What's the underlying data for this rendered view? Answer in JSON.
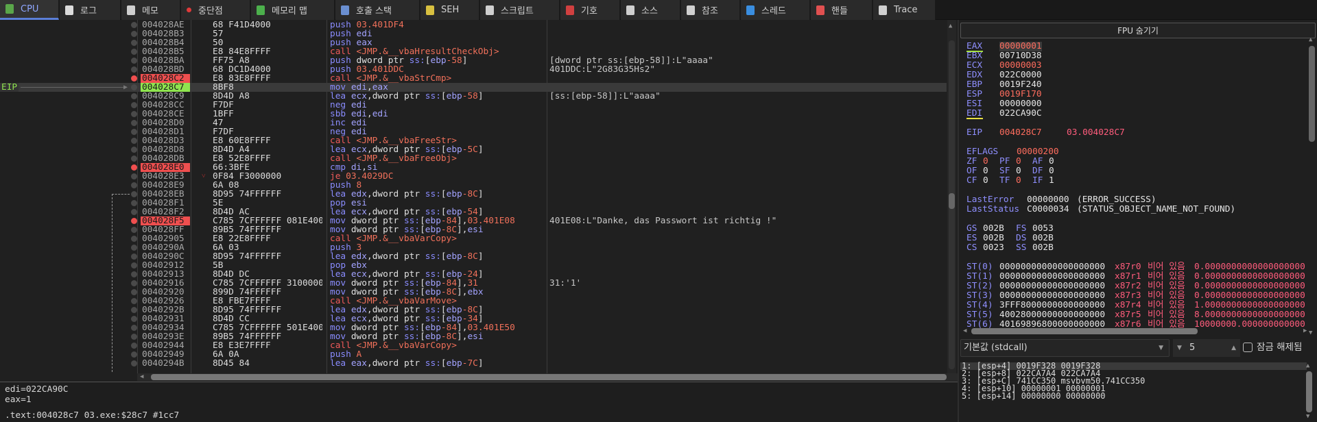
{
  "tabs": [
    {
      "label": "CPU",
      "active": true,
      "icon_color": "#5aa64a",
      "icon": "cpu-icon"
    },
    {
      "label": "로그",
      "icon_color": "#dcdcdc",
      "icon": "log-icon"
    },
    {
      "label": "메모",
      "icon_color": "#cfcfcf",
      "icon": "notes-icon"
    },
    {
      "label": "중단점",
      "icon_color": "#e03a3a",
      "icon": "breakpoint-icon"
    },
    {
      "label": "메모리 맵",
      "icon_color": "#4cb04c",
      "icon": "memory-map-icon"
    },
    {
      "label": "호출 스택",
      "icon_color": "#6a8fd0",
      "icon": "call-stack-icon"
    },
    {
      "label": "SEH",
      "icon_color": "#d8c040",
      "icon": "seh-icon"
    },
    {
      "label": "스크립트",
      "icon_color": "#d0d0d0",
      "icon": "script-icon"
    },
    {
      "label": "기호",
      "icon_color": "#d04040",
      "icon": "symbols-icon"
    },
    {
      "label": "소스",
      "icon_color": "#cfcfcf",
      "icon": "source-icon"
    },
    {
      "label": "참조",
      "icon_color": "#d0d0d0",
      "icon": "references-icon"
    },
    {
      "label": "스레드",
      "icon_color": "#3a8ee0",
      "icon": "threads-icon"
    },
    {
      "label": "핸들",
      "icon_color": "#e05050",
      "icon": "handles-icon"
    },
    {
      "label": "Trace",
      "icon_color": "#d0d0d0",
      "icon": "trace-icon"
    }
  ],
  "eip_label": "EIP",
  "disasm": [
    {
      "addr": "004028AE",
      "bytes": "68 ",
      "bytes_ul": "F41D4000",
      "ins": "push 03.401DF4",
      "cmt": ""
    },
    {
      "addr": "004028B3",
      "bytes": "57",
      "ins": "push edi",
      "cmt": ""
    },
    {
      "addr": "004028B4",
      "bytes": "50",
      "ins": "push eax",
      "cmt": ""
    },
    {
      "addr": "004028B5",
      "bytes": "E8 84E8FFFF",
      "ins": "call <JMP.&__vbaHresultCheckObj>",
      "cmt": ""
    },
    {
      "addr": "004028BA",
      "bytes": "FF75 A8",
      "ins": "push dword ptr ss:[ebp-58]",
      "cmt": "[dword ptr ss:[ebp-58]]:L\"aaaa\""
    },
    {
      "addr": "004028BD",
      "bytes": "68 ",
      "bytes_ul": "DC1D4000",
      "ins": "push 03.401DDC",
      "cmt": "401DDC:L\"2G83G35Hs2\""
    },
    {
      "addr": "004028C2",
      "bp": true,
      "bytes": "E8 83E8FFFF",
      "ins": "call <JMP.&__vbaStrCmp>",
      "cmt": ""
    },
    {
      "addr": "004028C7",
      "eip": true,
      "bytes": "8BF8",
      "ins": "mov edi,eax",
      "cmt": ""
    },
    {
      "addr": "004028C9",
      "bytes": "8D4D A8",
      "ins": "lea ecx,dword ptr ss:[ebp-58]",
      "cmt": "[ss:[ebp-58]]:L\"aaaa\""
    },
    {
      "addr": "004028CC",
      "bytes": "F7DF",
      "ins": "neg edi",
      "cmt": ""
    },
    {
      "addr": "004028CE",
      "bytes": "1BFF",
      "ins": "sbb edi,edi",
      "cmt": ""
    },
    {
      "addr": "004028D0",
      "bytes": "47",
      "ins": "inc edi",
      "cmt": ""
    },
    {
      "addr": "004028D1",
      "bytes": "F7DF",
      "ins": "neg edi",
      "cmt": ""
    },
    {
      "addr": "004028D3",
      "bytes": "E8 60E8FFFF",
      "ins": "call <JMP.&__vbaFreeStr>",
      "cmt": ""
    },
    {
      "addr": "004028D8",
      "bytes": "8D4D A4",
      "ins": "lea ecx,dword ptr ss:[ebp-5C]",
      "cmt": ""
    },
    {
      "addr": "004028DB",
      "bytes": "E8 52E8FFFF",
      "ins": "call <JMP.&__vbaFreeObj>",
      "cmt": ""
    },
    {
      "addr": "004028E0",
      "bp": true,
      "bytes": "66:3BFE",
      "ins": "cmp di,si",
      "cmt": ""
    },
    {
      "addr": "004028E3",
      "jump": true,
      "bytes": "0F84 F3000000",
      "ins": "je 03.4029DC",
      "cmt": ""
    },
    {
      "addr": "004028E9",
      "bytes": "6A 08",
      "ins": "push 8",
      "cmt": ""
    },
    {
      "addr": "004028EB",
      "bytes": "8D95 74FFFFFF",
      "ins": "lea edx,dword ptr ss:[ebp-8C]",
      "cmt": ""
    },
    {
      "addr": "004028F1",
      "bytes": "5E",
      "ins": "pop esi",
      "cmt": ""
    },
    {
      "addr": "004028F2",
      "bytes": "8D4D AC",
      "ins": "lea ecx,dword ptr ss:[ebp-54]",
      "cmt": ""
    },
    {
      "addr": "004028F5",
      "bp": true,
      "bytes": "C785 7CFFFFFF ",
      "bytes_ul": "081E400",
      "ins": "mov dword ptr ss:[ebp-84],03.401E08",
      "cmt": "401E08:L\"Danke, das Passwort ist richtig !\""
    },
    {
      "addr": "004028FF",
      "bytes": "89B5 74FFFFFF",
      "ins": "mov dword ptr ss:[ebp-8C],esi",
      "cmt": ""
    },
    {
      "addr": "00402905",
      "bytes": "E8 22E8FFFF",
      "ins": "call <JMP.&__vbaVarCopy>",
      "cmt": ""
    },
    {
      "addr": "0040290A",
      "bytes": "6A 03",
      "ins": "push 3",
      "cmt": ""
    },
    {
      "addr": "0040290C",
      "bytes": "8D95 74FFFFFF",
      "ins": "lea edx,dword ptr ss:[ebp-8C]",
      "cmt": ""
    },
    {
      "addr": "00402912",
      "bytes": "5B",
      "ins": "pop ebx",
      "cmt": ""
    },
    {
      "addr": "00402913",
      "bytes": "8D4D DC",
      "ins": "lea ecx,dword ptr ss:[ebp-24]",
      "cmt": ""
    },
    {
      "addr": "00402916",
      "bytes": "C785 7CFFFFFF 3100000",
      "ins": "mov dword ptr ss:[ebp-84],31",
      "cmt": "31:'1'"
    },
    {
      "addr": "00402920",
      "bytes": "899D 74FFFFFF",
      "ins": "mov dword ptr ss:[ebp-8C],ebx",
      "cmt": ""
    },
    {
      "addr": "00402926",
      "bytes": "E8 FBE7FFFF",
      "ins": "call <JMP.&__vbaVarMove>",
      "cmt": ""
    },
    {
      "addr": "0040292B",
      "bytes": "8D95 74FFFFFF",
      "ins": "lea edx,dword ptr ss:[ebp-8C]",
      "cmt": ""
    },
    {
      "addr": "00402931",
      "bytes": "8D4D CC",
      "ins": "lea ecx,dword ptr ss:[ebp-34]",
      "cmt": ""
    },
    {
      "addr": "00402934",
      "bytes": "C785 7CFFFFFF ",
      "bytes_ul": "501E400",
      "ins": "mov dword ptr ss:[ebp-84],03.401E50",
      "cmt": ""
    },
    {
      "addr": "0040293E",
      "bytes": "89B5 74FFFFFF",
      "ins": "mov dword ptr ss:[ebp-8C],esi",
      "cmt": ""
    },
    {
      "addr": "00402944",
      "bytes": "E8 E3E7FFFF",
      "ins": "call <JMP.&__vbaVarCopy>",
      "cmt": ""
    },
    {
      "addr": "00402949",
      "bytes": "6A 0A",
      "ins": "push A",
      "cmt": ""
    },
    {
      "addr": "0040294B",
      "bytes": "8D45 84",
      "ins": "lea eax,dword ptr ss:[ebp-7C]",
      "cmt": ""
    }
  ],
  "info": {
    "line1": "edi=022CA90C",
    "line2": "eax=1",
    "status": ".text:004028c7 03.exe:$28c7 #1cc7"
  },
  "fpu_button": "FPU 숨기기",
  "registers": [
    {
      "name": "EAX",
      "value": "00000001",
      "changed": true,
      "underline": "#a4e040",
      "selected": true
    },
    {
      "name": "EBX",
      "value": "00710D38"
    },
    {
      "name": "ECX",
      "value": "00000003",
      "changed": true
    },
    {
      "name": "EDX",
      "value": "022C0000"
    },
    {
      "name": "EBP",
      "value": "0019F240"
    },
    {
      "name": "ESP",
      "value": "0019F170",
      "changed": true
    },
    {
      "name": "ESI",
      "value": "00000000"
    },
    {
      "name": "EDI",
      "value": "022CA90C",
      "underline": "#e8e040"
    }
  ],
  "eip": {
    "name": "EIP",
    "value": "004028C7",
    "symbol": "03.004028C7"
  },
  "eflags": {
    "name": "EFLAGS",
    "value": "00000200"
  },
  "flags": [
    [
      {
        "n": "ZF",
        "v": "0",
        "c": true
      },
      {
        "n": "PF",
        "v": "0",
        "c": true
      },
      {
        "n": "AF",
        "v": "0"
      }
    ],
    [
      {
        "n": "OF",
        "v": "0"
      },
      {
        "n": "SF",
        "v": "0"
      },
      {
        "n": "DF",
        "v": "0"
      }
    ],
    [
      {
        "n": "CF",
        "v": "0"
      },
      {
        "n": "TF",
        "v": "0",
        "c": true
      },
      {
        "n": "IF",
        "v": "1"
      }
    ]
  ],
  "last_error": {
    "name": "LastError",
    "value": "00000000",
    "desc": "(ERROR_SUCCESS)"
  },
  "last_status": {
    "name": "LastStatus",
    "value": "C0000034",
    "desc": "(STATUS_OBJECT_NAME_NOT_FOUND)"
  },
  "segments": [
    [
      {
        "n": "GS",
        "v": "002B"
      },
      {
        "n": "FS",
        "v": "0053"
      }
    ],
    [
      {
        "n": "ES",
        "v": "002B"
      },
      {
        "n": "DS",
        "v": "002B"
      }
    ],
    [
      {
        "n": "CS",
        "v": "0023"
      },
      {
        "n": "SS",
        "v": "002B"
      }
    ]
  ],
  "fpu": [
    {
      "n": "ST(0)",
      "raw": "00000000000000000000",
      "reg": "x87r0",
      "tag": "비어 있음",
      "val": "0.0000000000000000000"
    },
    {
      "n": "ST(1)",
      "raw": "00000000000000000000",
      "reg": "x87r1",
      "tag": "비어 있음",
      "val": "0.0000000000000000000"
    },
    {
      "n": "ST(2)",
      "raw": "00000000000000000000",
      "reg": "x87r2",
      "tag": "비어 있음",
      "val": "0.0000000000000000000"
    },
    {
      "n": "ST(3)",
      "raw": "00000000000000000000",
      "reg": "x87r3",
      "tag": "비어 있음",
      "val": "0.0000000000000000000"
    },
    {
      "n": "ST(4)",
      "raw": "3FFF8000000000000000",
      "reg": "x87r4",
      "tag": "비어 있음",
      "val": "1.0000000000000000000"
    },
    {
      "n": "ST(5)",
      "raw": "40028000000000000000",
      "reg": "x87r5",
      "tag": "비어 있음",
      "val": "8.0000000000000000000"
    },
    {
      "n": "ST(6)",
      "raw": "40169896800000000000",
      "reg": "x87r6",
      "tag": "비어 있음",
      "val": "10000000.000000000000"
    }
  ],
  "stack": {
    "convention": "기본값 (stdcall)",
    "count": "5",
    "unlock_label": "잠금 해제됨",
    "rows": [
      "1: [esp+4] 0019F328 0019F328",
      "2: [esp+8] 022CA7A4 022CA7A4",
      "3: [esp+C] 741CC350 msvbvm50.741CC350",
      "4: [esp+10] 00000001 00000001",
      "5: [esp+14] 00000000 00000000"
    ]
  }
}
